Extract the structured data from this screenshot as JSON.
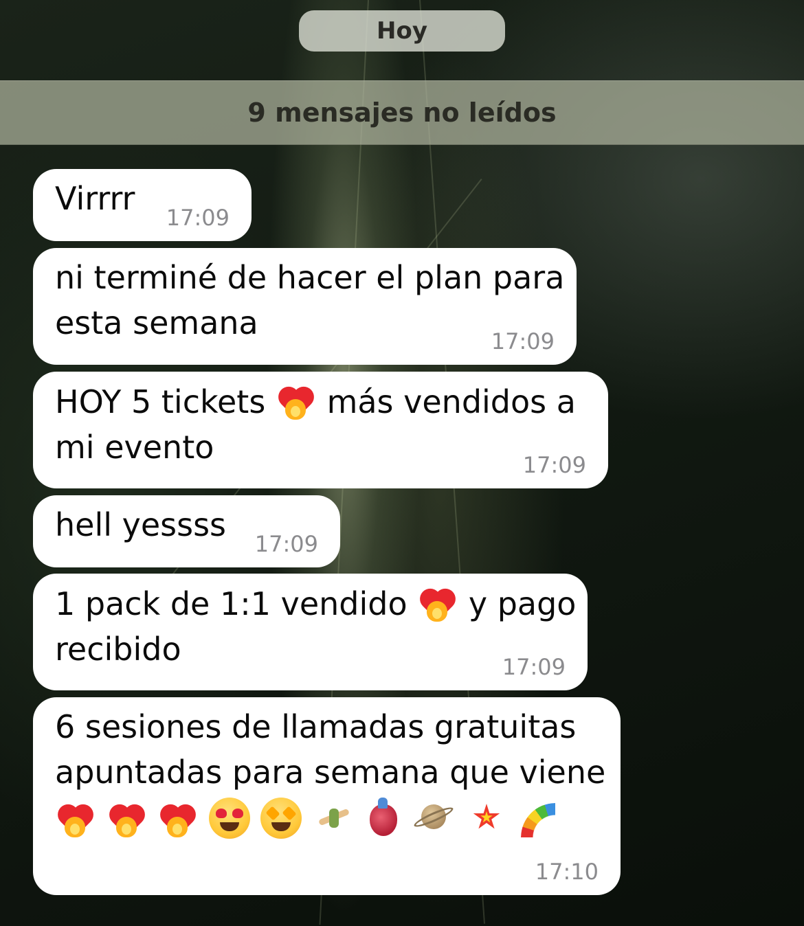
{
  "header": {
    "date_label": "Hoy",
    "unread_label": "9 mensajes no leídos"
  },
  "messages": [
    {
      "lines": [
        "Virrrr"
      ],
      "time": "17:09"
    },
    {
      "lines": [
        "ni terminé de hacer el plan para",
        "esta semana"
      ],
      "time": "17:09"
    },
    {
      "line1_a": "HOY 5 tickets",
      "line1_b": "más vendidos a",
      "line2": "mi evento",
      "emoji": "heart-on-fire",
      "time": "17:09"
    },
    {
      "lines": [
        "hell yessss"
      ],
      "time": "17:09"
    },
    {
      "line1_a": "1 pack de 1:1 vendido",
      "line1_b": "y pago",
      "line2": "recibido",
      "emoji": "heart-on-fire",
      "time": "17:09"
    },
    {
      "lines": [
        "6 sesiones de llamadas gratuitas",
        "apuntadas para semana que viene"
      ],
      "emojis": [
        "heart-on-fire",
        "heart-on-fire",
        "heart-on-fire",
        "heart-eyes-face",
        "star-struck-face",
        "cartwheel",
        "anatomical-heart",
        "ringed-planet",
        "collision",
        "rainbow"
      ],
      "time": "17:10"
    }
  ],
  "colors": {
    "bubble": "#ffffff",
    "time_text": "#8b8b8e",
    "date_pill": "#d7dad0",
    "unread_banner": "#afb49e"
  }
}
